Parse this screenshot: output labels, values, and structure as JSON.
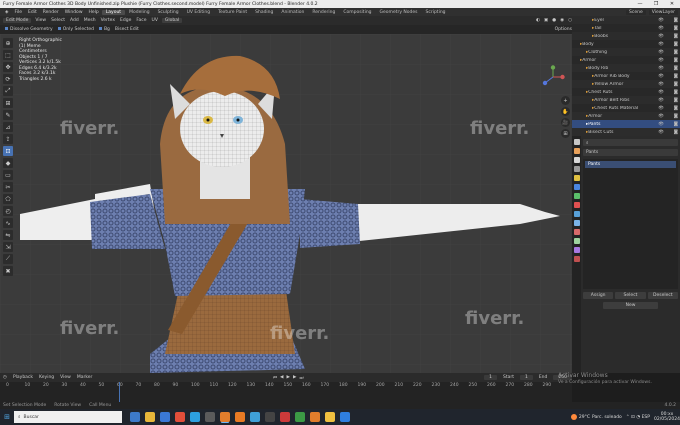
{
  "window": {
    "title": "Furry Female Armor Clothes 3D Body Unfinished.zip Plushie (Furry Clothes.second.model) Furry Female Armor Clothes.blend - Blender 4.0.2",
    "controls": [
      "—",
      "❐",
      "✕"
    ]
  },
  "menu": {
    "items": [
      "File",
      "Edit",
      "Render",
      "Window",
      "Help"
    ],
    "workspaces": [
      "Layout",
      "Modeling",
      "Sculpting",
      "UV Editing",
      "Texture Paint",
      "Shading",
      "Animation",
      "Rendering",
      "Compositing",
      "Geometry Nodes",
      "Scripting"
    ],
    "active_workspace": "Layout",
    "scene_label": "Scene",
    "view_layer_label": "ViewLayer"
  },
  "viewport_header": {
    "mode": "Edit Mode",
    "items": [
      "View",
      "Select",
      "Add",
      "Mesh",
      "Vertex",
      "Edge",
      "Face",
      "UV"
    ],
    "transform": "Global",
    "options": "Options"
  },
  "sub_header": {
    "checks": [
      "Dissolve Geometry",
      "Only Selected",
      "Bg"
    ],
    "dropdown": "Bisect Edit",
    "right": "Options"
  },
  "overlay": {
    "lines": [
      "Right Orthographic",
      "(1) Meme",
      "Centimeters",
      "",
      "Objects     1 / 7",
      "Vertices    3.2 k/1.5k",
      "Edges       6.4 k/3.2k",
      "Faces       3.2 k/3.1k",
      "Triangles   2.6 k"
    ]
  },
  "toolbar": {
    "tools": [
      "cursor-icon",
      "select-icon",
      "move-icon",
      "rotate-icon",
      "scale-icon",
      "transform-icon",
      "annotate-icon",
      "measure-icon",
      "extrude-icon",
      "inset-icon",
      "bevel-icon",
      "loopcut-icon",
      "knife-icon",
      "polybuild-icon",
      "spin-icon",
      "smooth-icon",
      "edge-slide-icon",
      "shrink-icon",
      "shear-icon",
      "rip-icon"
    ],
    "active_index": 9
  },
  "nav": {
    "buttons": [
      "+",
      "✋",
      "🎥",
      "⊞"
    ]
  },
  "outliner": {
    "rows": [
      {
        "label": "Eyel",
        "indent": 3,
        "sel": false
      },
      {
        "label": "Tail",
        "indent": 3,
        "sel": false
      },
      {
        "label": "Boobs",
        "indent": 3,
        "sel": false
      },
      {
        "label": "Body",
        "indent": 1,
        "sel": false
      },
      {
        "label": "Clothing",
        "indent": 2,
        "sel": false
      },
      {
        "label": "Armor",
        "indent": 1,
        "sel": false
      },
      {
        "label": "Body Rib",
        "indent": 2,
        "sel": false
      },
      {
        "label": "Armor Rib Body",
        "indent": 3,
        "sel": false
      },
      {
        "label": "Yellow Armor",
        "indent": 3,
        "sel": false
      },
      {
        "label": "Chest Ruts",
        "indent": 2,
        "sel": false
      },
      {
        "label": "Armor Belt Ribs",
        "indent": 3,
        "sel": false
      },
      {
        "label": "Chest Ruts Material",
        "indent": 3,
        "sel": false
      },
      {
        "label": "Armor",
        "indent": 2,
        "sel": false
      },
      {
        "label": "Pants",
        "indent": 2,
        "sel": true
      },
      {
        "label": "Bisect Cuts",
        "indent": 2,
        "sel": false
      }
    ]
  },
  "properties": {
    "search_placeholder": "",
    "object_name": "Pants",
    "material_item": "Pants",
    "buttons": [
      "Assign",
      "Select",
      "Deselect"
    ],
    "new_button": "New",
    "tab_colors": [
      "#c7c7c7",
      "#e8a15b",
      "#d8d8d8",
      "#9a9a9a",
      "#e0c040",
      "#4a86e0",
      "#5bbf6a",
      "#e05050",
      "#58a0d8",
      "#7ab4e8",
      "#d86a6a",
      "#9fd39f",
      "#a878e0",
      "#c05050"
    ]
  },
  "timeline_header": {
    "items": [
      "Playback",
      "Keying",
      "View",
      "Marker"
    ],
    "start_label": "Start",
    "start": "1",
    "end_label": "End",
    "end": "250"
  },
  "timeline": {
    "current_frame": "1",
    "ticks": [
      "0",
      "10",
      "20",
      "30",
      "40",
      "50",
      "60",
      "70",
      "80",
      "90",
      "100",
      "110",
      "120",
      "130",
      "140",
      "150",
      "160",
      "170",
      "180",
      "190",
      "200",
      "210",
      "220",
      "230",
      "240",
      "250",
      "260",
      "270",
      "280",
      "290"
    ]
  },
  "watermark": {
    "line1": "Activar Windows",
    "line2": "Ve a Configuración para activar Windows."
  },
  "status": {
    "left": [
      "Set Selection Mode",
      "Rotate View",
      "Call Menu"
    ],
    "right": "4.0.2"
  },
  "taskbar": {
    "search_placeholder": "Buscar",
    "app_colors": [
      "#3d7ac9",
      "#e8b73a",
      "#3a78d6",
      "#e24f3a",
      "#2da0e0",
      "#5b5b5b",
      "#e07d2c",
      "#e87a24",
      "#3fa0d8",
      "#444444",
      "#cc3a3a",
      "#3c9a45",
      "#e07d2c",
      "#f0c040",
      "#2f7fe0"
    ],
    "active_app": 6,
    "weather_temp": "29°C",
    "weather_desc": "Parc. soleado",
    "tray": "⌃  ⊡  ◔  ESP",
    "time": "00:xx",
    "date": "02/05/2024"
  }
}
